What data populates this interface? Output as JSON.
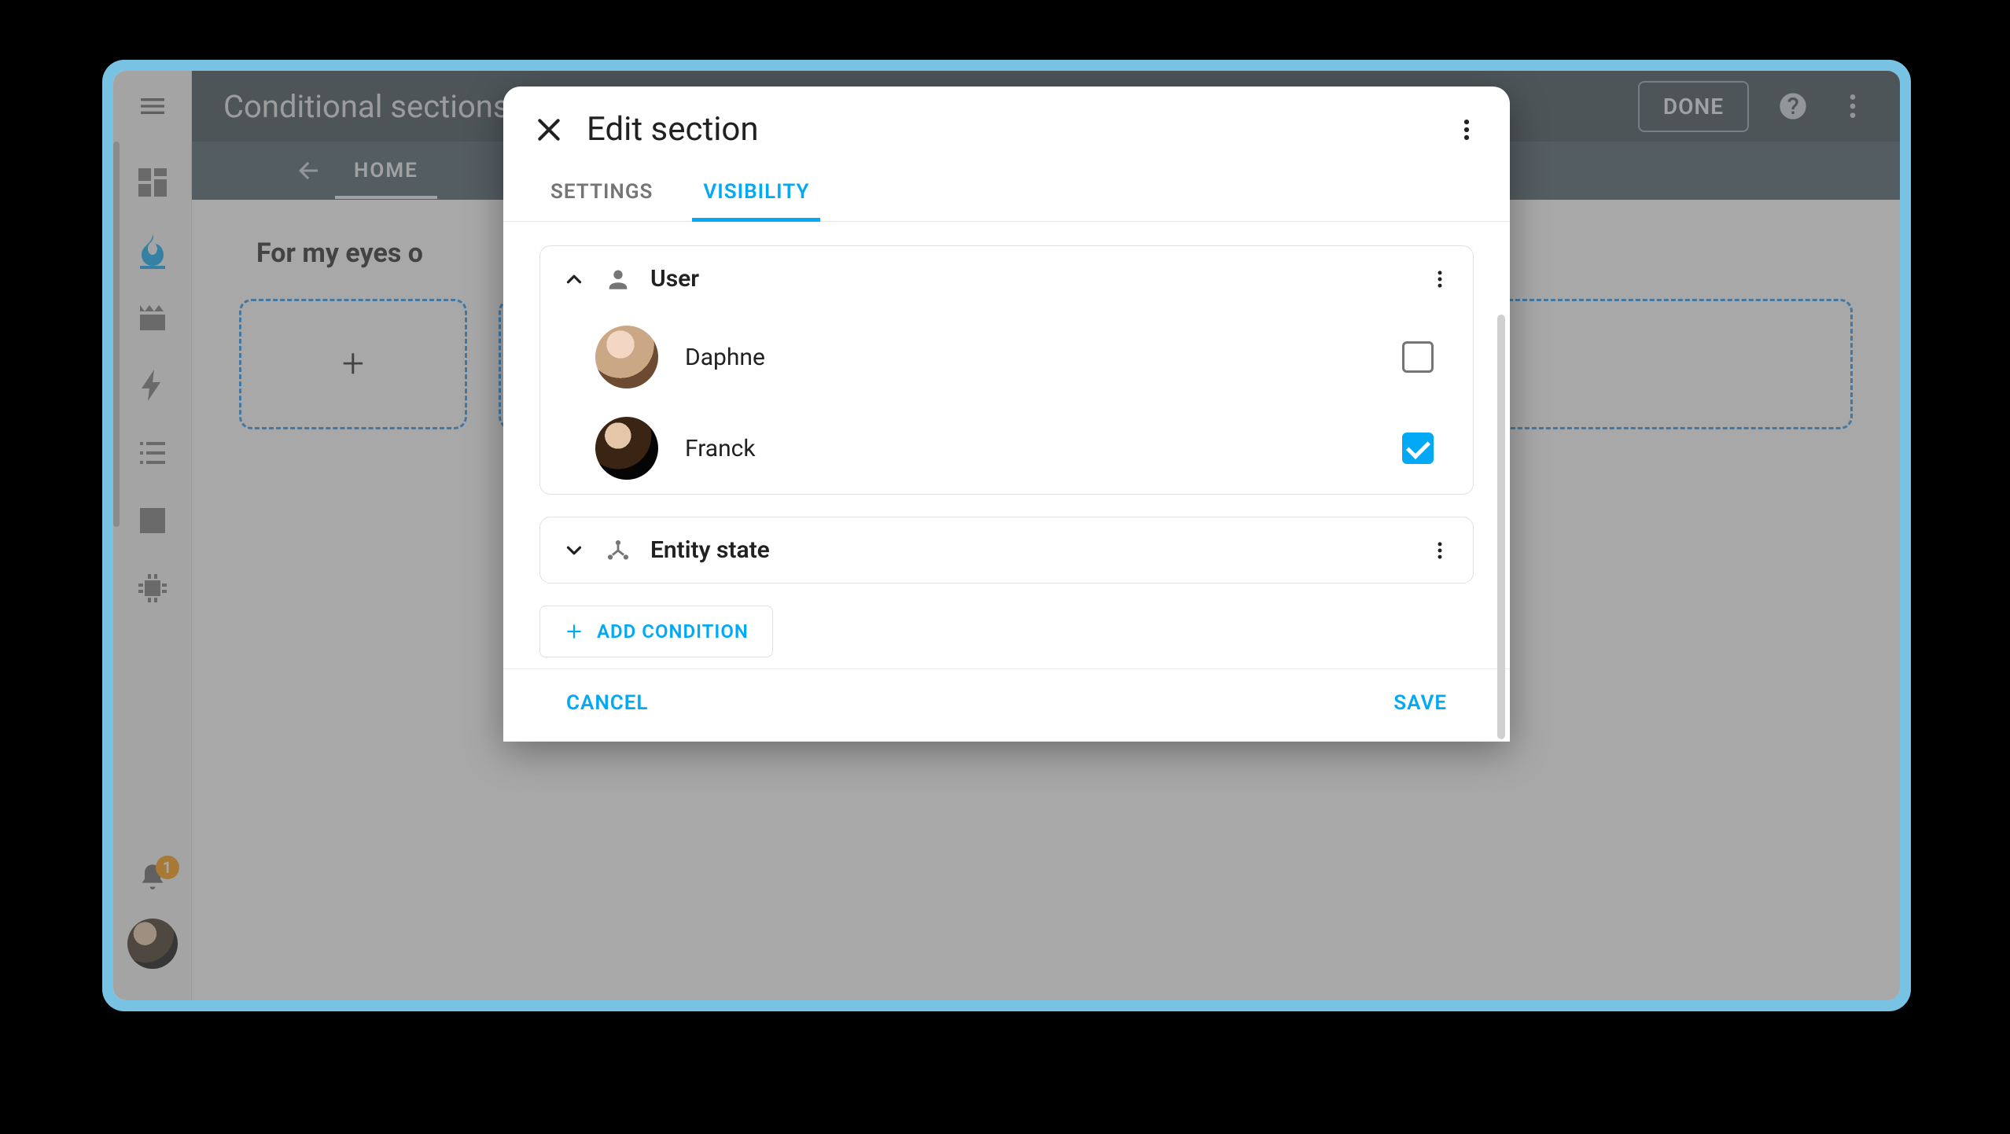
{
  "app": {
    "title": "Conditional sections!",
    "done_label": "DONE",
    "tabbar": {
      "back_label": "HOME"
    },
    "sidebar": {
      "badge_count": "1"
    }
  },
  "content": {
    "headline": "For my eyes o"
  },
  "dialog": {
    "title": "Edit section",
    "tabs": {
      "settings": "SETTINGS",
      "visibility": "VISIBILITY"
    },
    "conditions": {
      "user": {
        "title": "User",
        "users": [
          {
            "name": "Daphne",
            "checked": false
          },
          {
            "name": "Franck",
            "checked": true
          }
        ]
      },
      "entity_state": {
        "title": "Entity state"
      }
    },
    "add_condition": "ADD CONDITION",
    "cancel": "CANCEL",
    "save": "SAVE"
  }
}
